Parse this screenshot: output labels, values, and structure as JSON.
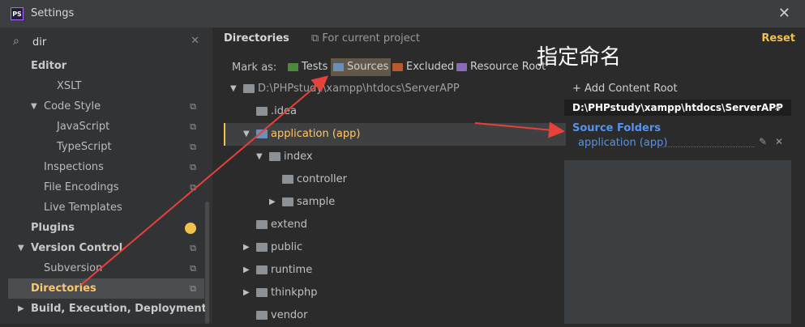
{
  "window": {
    "title": "Settings",
    "app_icon": "PS"
  },
  "search": {
    "value": "dir"
  },
  "sidebar": {
    "items": [
      {
        "label": "Editor"
      },
      {
        "label": "XSLT"
      },
      {
        "label": "Code Style"
      },
      {
        "label": "JavaScript"
      },
      {
        "label": "TypeScript"
      },
      {
        "label": "Inspections"
      },
      {
        "label": "File Encodings"
      },
      {
        "label": "Live Templates"
      },
      {
        "label": "Plugins"
      },
      {
        "label": "Version Control"
      },
      {
        "label": "Subversion"
      },
      {
        "label": "Directories"
      },
      {
        "label": "Build, Execution, Deployment"
      }
    ]
  },
  "header": {
    "title": "Directories",
    "project_scope": "For current project",
    "reset": "Reset"
  },
  "mark": {
    "label": "Mark as:",
    "buttons": [
      {
        "label": "Tests",
        "color": "#4e8a3e"
      },
      {
        "label": "Sources",
        "color": "#6b8fb8"
      },
      {
        "label": "Excluded",
        "color": "#b85a2e"
      },
      {
        "label": "Resource Root",
        "color": "#8a6bb8"
      }
    ]
  },
  "tree": {
    "rows": [
      {
        "label": "D:\\PHPstudy\\xampp\\htdocs\\ServerAPP"
      },
      {
        "label": ".idea"
      },
      {
        "label": "application (app)"
      },
      {
        "label": "index"
      },
      {
        "label": "controller"
      },
      {
        "label": "sample"
      },
      {
        "label": "extend"
      },
      {
        "label": "public"
      },
      {
        "label": "runtime"
      },
      {
        "label": "thinkphp"
      },
      {
        "label": "vendor"
      }
    ]
  },
  "content_root": {
    "add_label": "+ Add Content Root",
    "path": "D:\\PHPstudy\\xampp\\htdocs\\ServerAPP",
    "source_title": "Source Folders",
    "source_item": "application (app)"
  },
  "annotation": {
    "text": "指定命名",
    "arrow_color": "#e8413a"
  },
  "colors": {
    "accent": "#f0c24a",
    "link": "#5394ec",
    "selected_text": "#ffc66d"
  }
}
